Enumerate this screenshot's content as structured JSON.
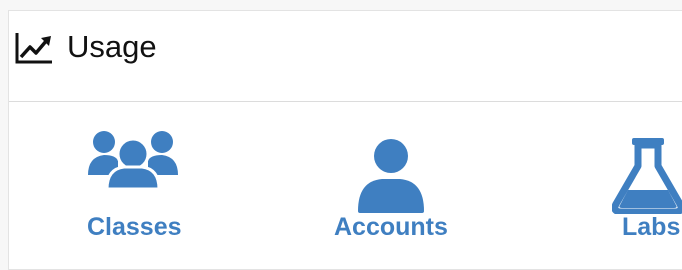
{
  "header": {
    "title": "Usage",
    "icon": "line-chart-icon"
  },
  "accent_color": "#3f7fc1",
  "items": [
    {
      "label": "Classes",
      "icon": "users-group-icon"
    },
    {
      "label": "Accounts",
      "icon": "user-icon"
    },
    {
      "label": "Labs",
      "icon": "flask-icon"
    }
  ]
}
